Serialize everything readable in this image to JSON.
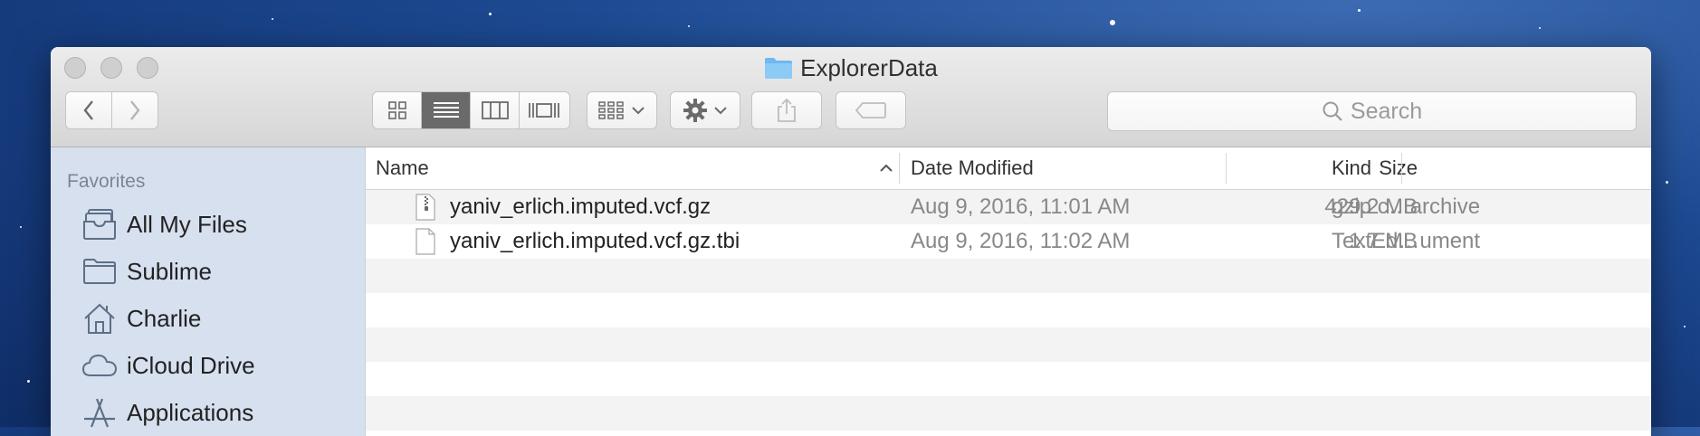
{
  "window": {
    "title": "ExplorerData"
  },
  "toolbar": {
    "back_icon": "chevron-left-icon",
    "forward_icon": "chevron-right-icon",
    "view_modes": [
      "icon-view-icon",
      "list-view-icon",
      "column-view-icon",
      "cover-flow-icon"
    ],
    "active_view": "list-view-icon",
    "search": {
      "placeholder": "Search"
    }
  },
  "sidebar": {
    "heading": "Favorites",
    "items": [
      {
        "label": "All My Files",
        "icon": "all-files-icon"
      },
      {
        "label": "Sublime",
        "icon": "folder-icon"
      },
      {
        "label": "Charlie",
        "icon": "home-icon"
      },
      {
        "label": "iCloud Drive",
        "icon": "cloud-icon"
      },
      {
        "label": "Applications",
        "icon": "applications-icon"
      }
    ]
  },
  "table": {
    "columns": {
      "name": "Name",
      "date": "Date Modified",
      "size": "Size",
      "kind": "Kind"
    },
    "rows": [
      {
        "name": "yaniv_erlich.imputed.vcf.gz",
        "date": "Aug 9, 2016, 11:01 AM",
        "size": "429.2 MB",
        "kind": "gzip c…archive",
        "icon": "zip-file-icon"
      },
      {
        "name": "yaniv_erlich.imputed.vcf.gz.tbi",
        "date": "Aug 9, 2016, 11:02 AM",
        "size": "1.7 MB",
        "kind": "TextEd…ument",
        "icon": "document-icon"
      }
    ]
  },
  "colors": {
    "sidebar_bg": "#d6e0ef",
    "desktop_bg": "#1d4a92",
    "row_alt": "#f3f3f3"
  }
}
